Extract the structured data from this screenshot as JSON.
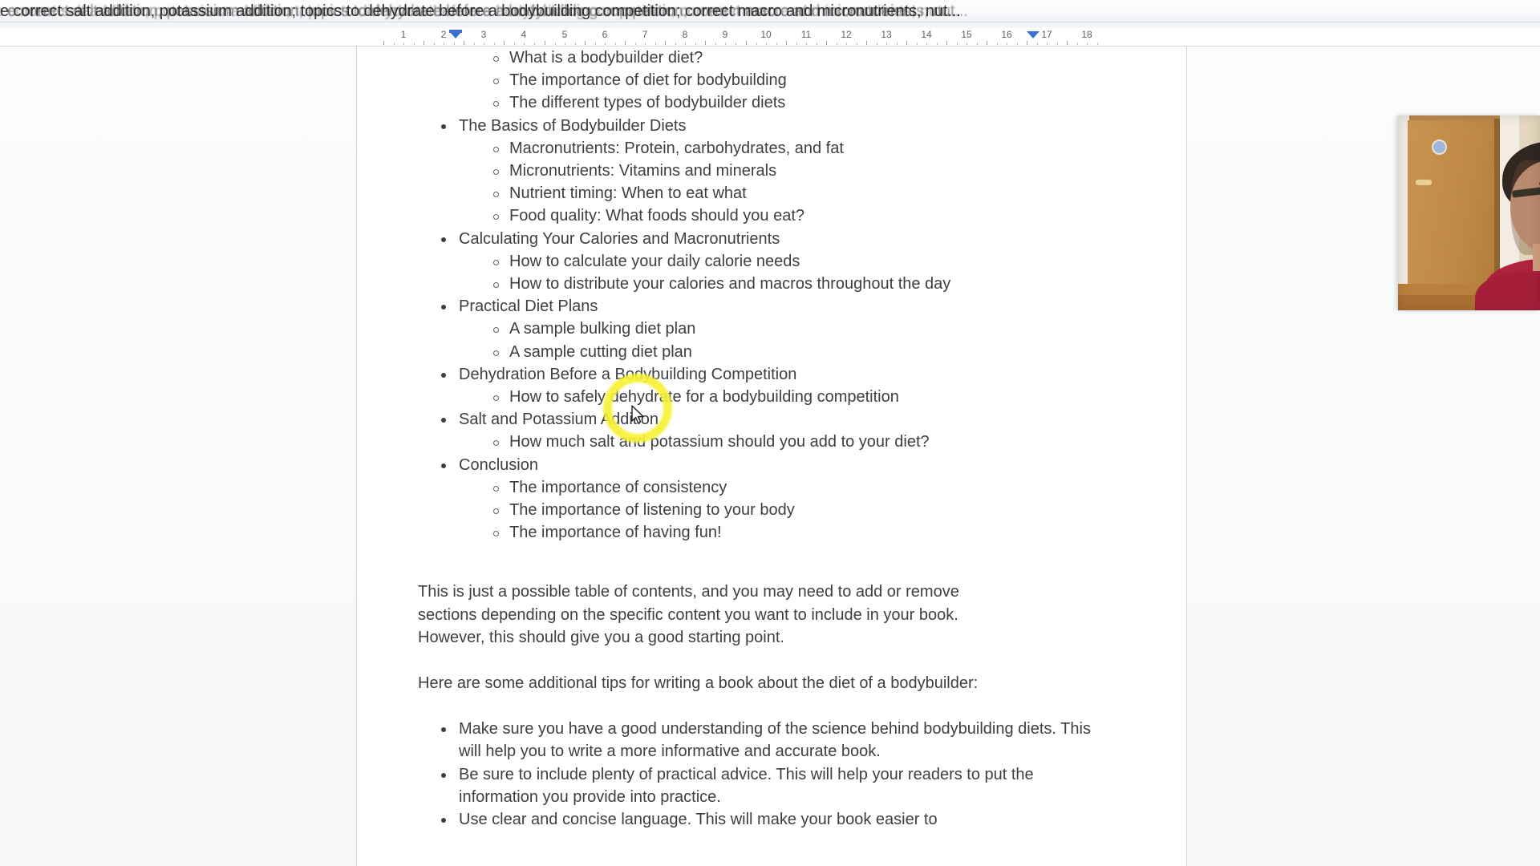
{
  "titlebar": {
    "text": "e correct salt addition, potassium addition; topics to dehydrate before a bodybuilding competition; correct macro and micronutrients, nut..."
  },
  "ruler": {
    "labels": [
      "2",
      "1",
      "1",
      "2",
      "3",
      "4",
      "5",
      "6",
      "7",
      "8",
      "9",
      "10",
      "11",
      "12",
      "13",
      "14",
      "15",
      "16",
      "17",
      "18"
    ],
    "left_indent_label": "left-indent-marker",
    "right_indent_label": "right-indent-marker"
  },
  "document": {
    "outline": [
      {
        "level": 2,
        "text": "What is a bodybuilder diet?"
      },
      {
        "level": 2,
        "text": "The importance of diet for bodybuilding"
      },
      {
        "level": 2,
        "text": "The different types of bodybuilder diets"
      },
      {
        "level": 1,
        "text": "The Basics of Bodybuilder Diets"
      },
      {
        "level": 2,
        "text": "Macronutrients: Protein, carbohydrates, and fat"
      },
      {
        "level": 2,
        "text": "Micronutrients: Vitamins and minerals"
      },
      {
        "level": 2,
        "text": "Nutrient timing: When to eat what"
      },
      {
        "level": 2,
        "text": "Food quality: What foods should you eat?"
      },
      {
        "level": 1,
        "text": "Calculating Your Calories and Macronutrients"
      },
      {
        "level": 2,
        "text": "How to calculate your daily calorie needs"
      },
      {
        "level": 2,
        "text": "How to distribute your calories and macros throughout the day"
      },
      {
        "level": 1,
        "text": "Practical Diet Plans"
      },
      {
        "level": 2,
        "text": "A sample bulking diet plan"
      },
      {
        "level": 2,
        "text": "A sample cutting diet plan"
      },
      {
        "level": 1,
        "text": "Dehydration Before a Bodybuilding Competition"
      },
      {
        "level": 2,
        "text": "How to safely dehydrate for a bodybuilding competition"
      },
      {
        "level": 1,
        "text": "Salt and Potassium Addition"
      },
      {
        "level": 2,
        "text": "How much salt and potassium should you add to your diet?"
      },
      {
        "level": 1,
        "text": "Conclusion"
      },
      {
        "level": 2,
        "text": "The importance of consistency"
      },
      {
        "level": 2,
        "text": "The importance of listening to your body"
      },
      {
        "level": 2,
        "text": "The importance of having fun!"
      }
    ],
    "paragraph_1": "This is just a possible table of contents, and you may need to add or remove sections depending on the specific content you want to include in your book. However, this should give you a good starting point.",
    "paragraph_2": "Here are some additional tips for writing a book about the diet of a bodybuilder:",
    "tips": [
      "Make sure you have a good understanding of the science behind bodybuilding diets. This will help you to write a more informative and accurate book.",
      "Be sure to include plenty of practical advice. This will help your readers to put the information you provide into practice.",
      "Use clear and concise language. This will make your book easier to"
    ]
  },
  "overlay": {
    "cursor_highlight_color": "#f6f134",
    "webcam_label": "webcam-overlay"
  }
}
